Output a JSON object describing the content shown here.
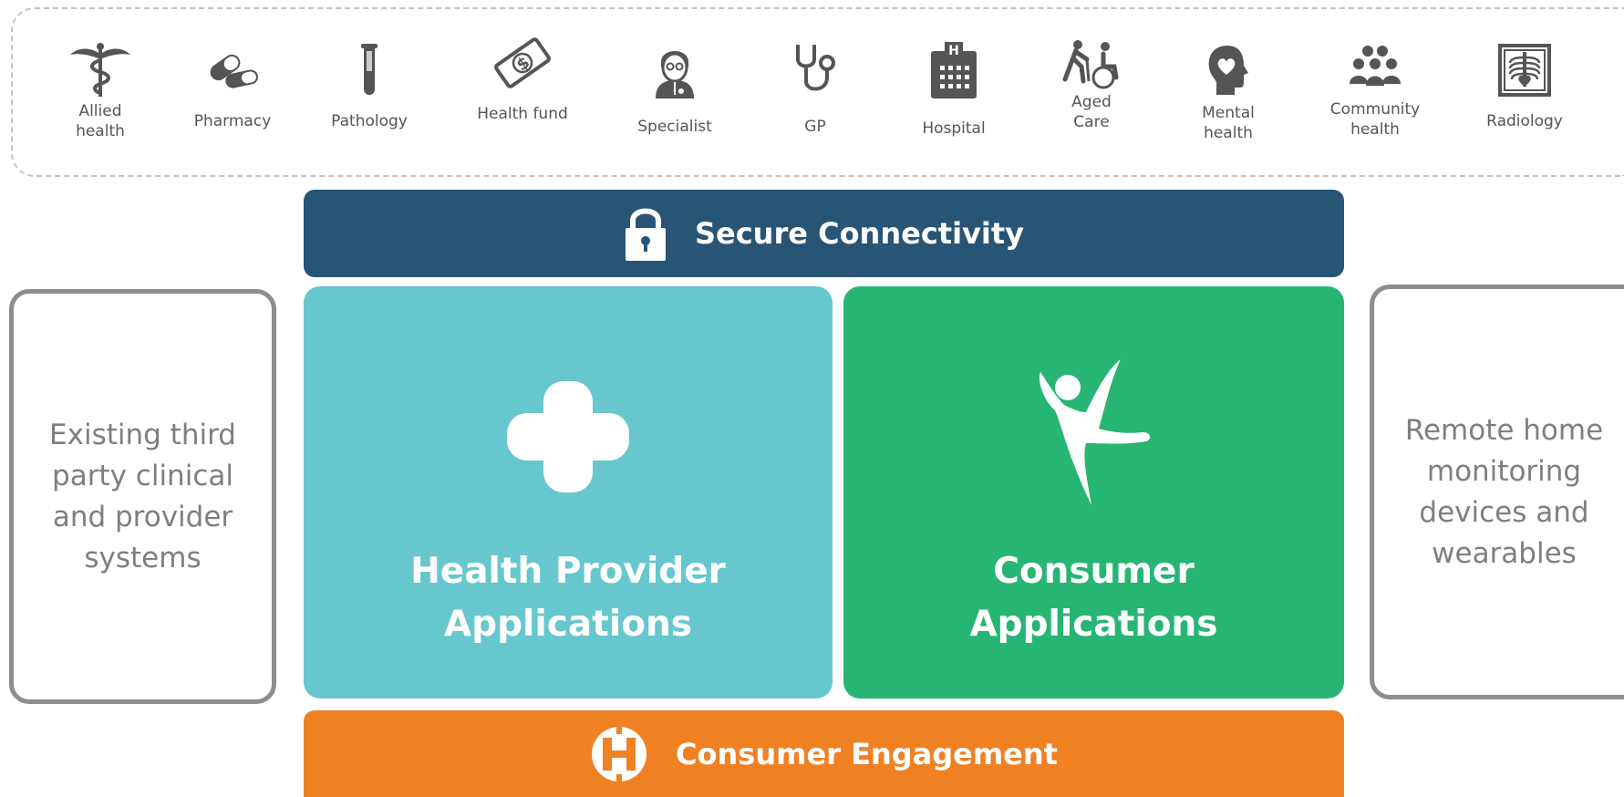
{
  "stakeholders": [
    {
      "label": "Allied\nhealth",
      "icon": "caduceus-icon"
    },
    {
      "label": "Pharmacy",
      "icon": "pills-icon"
    },
    {
      "label": "Pathology",
      "icon": "test-tube-icon"
    },
    {
      "label": "Health fund",
      "icon": "dollar-bill-icon"
    },
    {
      "label": "Specialist",
      "icon": "doctor-icon"
    },
    {
      "label": "GP",
      "icon": "stethoscope-icon"
    },
    {
      "label": "Hospital",
      "icon": "hospital-building-icon"
    },
    {
      "label": "Aged\nCare",
      "icon": "walker-wheelchair-icon"
    },
    {
      "label": "Mental\nhealth",
      "icon": "head-heart-icon"
    },
    {
      "label": "Community\nhealth",
      "icon": "people-group-icon"
    },
    {
      "label": "Radiology",
      "icon": "xray-icon"
    }
  ],
  "secure_connectivity": {
    "label": "Secure Connectivity",
    "icon": "padlock-icon"
  },
  "provider_apps": {
    "label": "Health Provider\nApplications",
    "icon": "medical-cross-icon"
  },
  "consumer_apps": {
    "label": "Consumer\nApplications",
    "icon": "happy-person-icon"
  },
  "left_box": {
    "label": "Existing third\nparty clinical\nand provider\nsystems"
  },
  "right_box": {
    "label": "Remote home\nmonitoring\ndevices and\nwearables"
  },
  "consumer_engagement": {
    "label": "Consumer Engagement",
    "icon": "engagement-logo-icon"
  },
  "colors": {
    "secure": "#285476",
    "provider": "#67c7ce",
    "consumer": "#27b573",
    "engagement": "#f08123",
    "side_border": "#8d8d8d",
    "icon_gray": "#555555"
  }
}
